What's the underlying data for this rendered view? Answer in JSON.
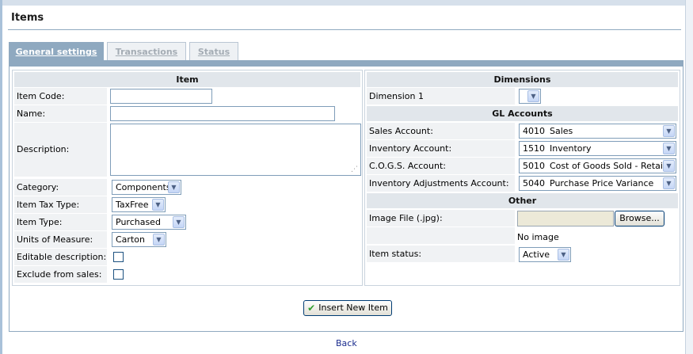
{
  "page": {
    "title": "Items"
  },
  "tabs": [
    {
      "label": "General settings",
      "active": true
    },
    {
      "label": "Transactions",
      "active": false
    },
    {
      "label": "Status",
      "active": false
    }
  ],
  "item_section": {
    "header": "Item",
    "item_code_label": "Item Code:",
    "item_code_value": "",
    "name_label": "Name:",
    "name_value": "",
    "description_label": "Description:",
    "description_value": "",
    "category_label": "Category:",
    "category_value": "Components",
    "tax_type_label": "Item Tax Type:",
    "tax_type_value": "TaxFree",
    "item_type_label": "Item Type:",
    "item_type_value": "Purchased",
    "units_label": "Units of Measure:",
    "units_value": "Carton",
    "editable_desc_label": "Editable description:",
    "editable_desc_checked": false,
    "exclude_sales_label": "Exclude from sales:",
    "exclude_sales_checked": false
  },
  "dimensions": {
    "header": "Dimensions",
    "dimension1_label": "Dimension 1",
    "dimension1_value": ""
  },
  "gl_accounts": {
    "header": "GL Accounts",
    "sales_label": "Sales Account:",
    "sales_code": "4010",
    "sales_name": "Sales",
    "inventory_label": "Inventory Account:",
    "inventory_code": "1510",
    "inventory_name": "Inventory",
    "cogs_label": "C.O.G.S. Account:",
    "cogs_code": "5010",
    "cogs_name": "Cost of Goods Sold - Retail",
    "adjust_label": "Inventory Adjustments Account:",
    "adjust_code": "5040",
    "adjust_name": "Purchase Price Variance"
  },
  "other": {
    "header": "Other",
    "image_label": "Image File (.jpg):",
    "browse_label": "Browse...",
    "no_image_text": "No image",
    "status_label": "Item status:",
    "status_value": "Active"
  },
  "actions": {
    "insert_label": "Insert New Item",
    "back_label": "Back"
  },
  "colors": {
    "accent": "#8fa9c0",
    "section": "#e1e6eb",
    "label_bg": "#f0f2f4",
    "link": "#1a2c8e"
  }
}
